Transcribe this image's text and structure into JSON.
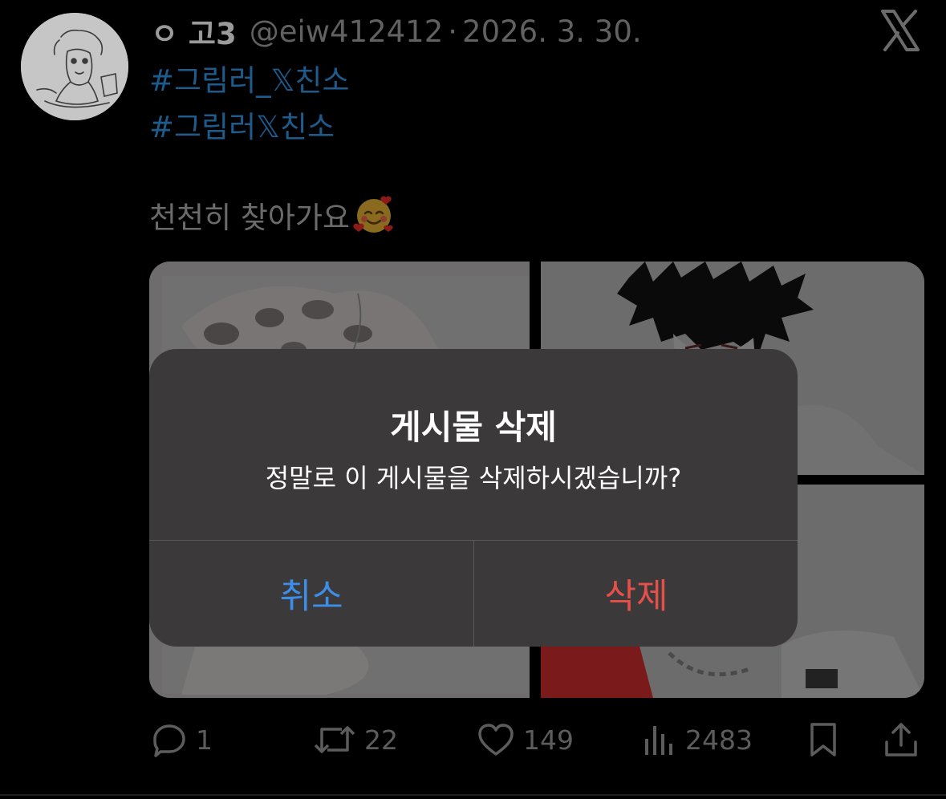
{
  "tweet": {
    "display_name": "ㅇ 고3",
    "handle": "@eiw412412",
    "separator": "·",
    "date": "2026. 3. 30.",
    "hashtags": [
      "#그림러_𝕏친소",
      "#그림러𝕏친소"
    ],
    "body_text": "천천히 찾아가요",
    "emoji": "smiling-face-with-hearts"
  },
  "actions": {
    "replies": "1",
    "reposts": "22",
    "likes": "149",
    "views": "2483"
  },
  "alert": {
    "title": "게시물 삭제",
    "message": "정말로 이 게시물을 삭제하시겠습니까?",
    "cancel_label": "취소",
    "delete_label": "삭제"
  },
  "colors": {
    "background": "#000000",
    "hashtag": "#1c5b8b",
    "alert_background": "#3b393a",
    "cancel": "#3d8ee8",
    "destructive": "#e5504a"
  },
  "icons": [
    "x-logo-icon",
    "reply-icon",
    "repost-icon",
    "like-icon",
    "views-icon",
    "bookmark-icon",
    "share-icon"
  ]
}
